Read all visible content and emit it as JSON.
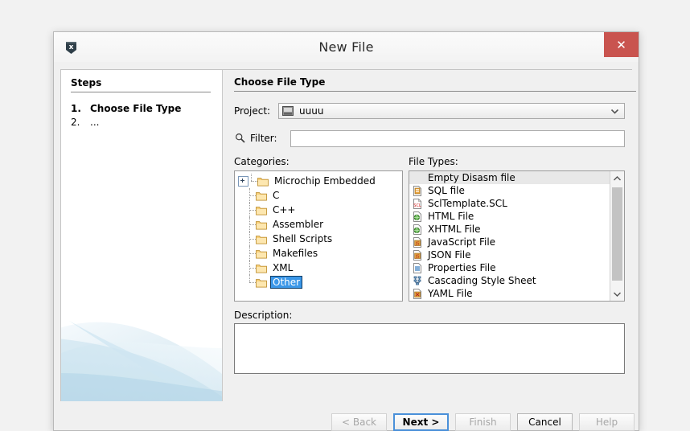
{
  "window": {
    "title": "New File",
    "app_icon": "x-badge-icon",
    "close_label": "✕"
  },
  "steps": {
    "header": "Steps",
    "items": [
      {
        "num": "1.",
        "label": "Choose File Type",
        "current": true
      },
      {
        "num": "2.",
        "label": "...",
        "current": false
      }
    ]
  },
  "main": {
    "section_title": "Choose File Type",
    "project": {
      "label": "Project:",
      "value": "uuuu",
      "icon": "project-icon",
      "arrow_icon": "chevron-down-icon"
    },
    "filter": {
      "label": "Filter:",
      "value": "",
      "placeholder": "",
      "icon": "search-icon"
    },
    "categories": {
      "label": "Categories:",
      "items": [
        {
          "label": "Microchip Embedded",
          "expandable": true,
          "selected": false
        },
        {
          "label": "C",
          "expandable": false,
          "selected": false
        },
        {
          "label": "C++",
          "expandable": false,
          "selected": false
        },
        {
          "label": "Assembler",
          "expandable": false,
          "selected": false
        },
        {
          "label": "Shell Scripts",
          "expandable": false,
          "selected": false
        },
        {
          "label": "Makefiles",
          "expandable": false,
          "selected": false
        },
        {
          "label": "XML",
          "expandable": false,
          "selected": false
        },
        {
          "label": "Other",
          "expandable": false,
          "selected": true
        }
      ]
    },
    "file_types": {
      "label": "File Types:",
      "items": [
        {
          "label": "Empty Disasm file",
          "icon": "none",
          "selected": true
        },
        {
          "label": "SQL file",
          "icon": "sql-icon",
          "selected": false
        },
        {
          "label": "SclTemplate.SCL",
          "icon": "scl-icon",
          "selected": false
        },
        {
          "label": "HTML File",
          "icon": "html-icon",
          "selected": false
        },
        {
          "label": "XHTML File",
          "icon": "xhtml-icon",
          "selected": false
        },
        {
          "label": "JavaScript File",
          "icon": "js-icon",
          "selected": false
        },
        {
          "label": "JSON File",
          "icon": "json-icon",
          "selected": false
        },
        {
          "label": "Properties File",
          "icon": "properties-icon",
          "selected": false
        },
        {
          "label": "Cascading Style Sheet",
          "icon": "css-icon",
          "selected": false
        },
        {
          "label": "YAML File",
          "icon": "yaml-icon",
          "selected": false
        }
      ],
      "scrollbar": {
        "up_icon": "chevron-up-icon",
        "down_icon": "chevron-down-icon"
      }
    },
    "description": {
      "label": "Description:",
      "value": ""
    }
  },
  "buttons": {
    "back": {
      "label": "< Back",
      "enabled": false,
      "default": false
    },
    "next": {
      "label": "Next >",
      "enabled": true,
      "default": true
    },
    "finish": {
      "label": "Finish",
      "enabled": false,
      "default": false
    },
    "cancel": {
      "label": "Cancel",
      "enabled": true,
      "default": false
    },
    "help": {
      "label": "Help",
      "enabled": false,
      "default": false
    }
  },
  "colors": {
    "close_red": "#c9544f",
    "selection_blue": "#3b97e8",
    "row_selection_grey": "#e8e8e8",
    "default_button_border": "#4a90d9"
  }
}
